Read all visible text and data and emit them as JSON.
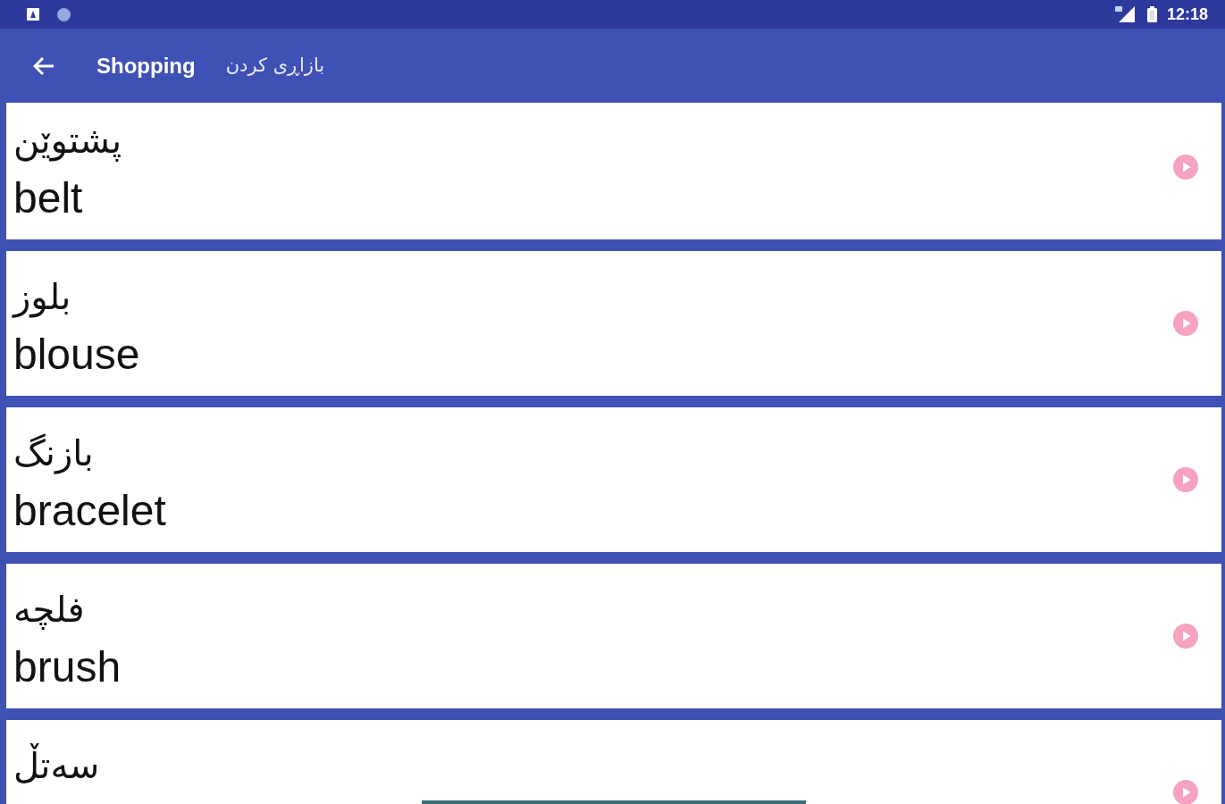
{
  "status_bar": {
    "time": "12:18"
  },
  "app_bar": {
    "title": "Shopping",
    "subtitle": "بازاڕی کردن"
  },
  "words": [
    {
      "kurdish": "پشتوێن",
      "english": "belt"
    },
    {
      "kurdish": "بلوز",
      "english": "blouse"
    },
    {
      "kurdish": "بازنگ",
      "english": "bracelet"
    },
    {
      "kurdish": "فلچە",
      "english": "brush"
    },
    {
      "kurdish": "سەتڵ"
    }
  ]
}
